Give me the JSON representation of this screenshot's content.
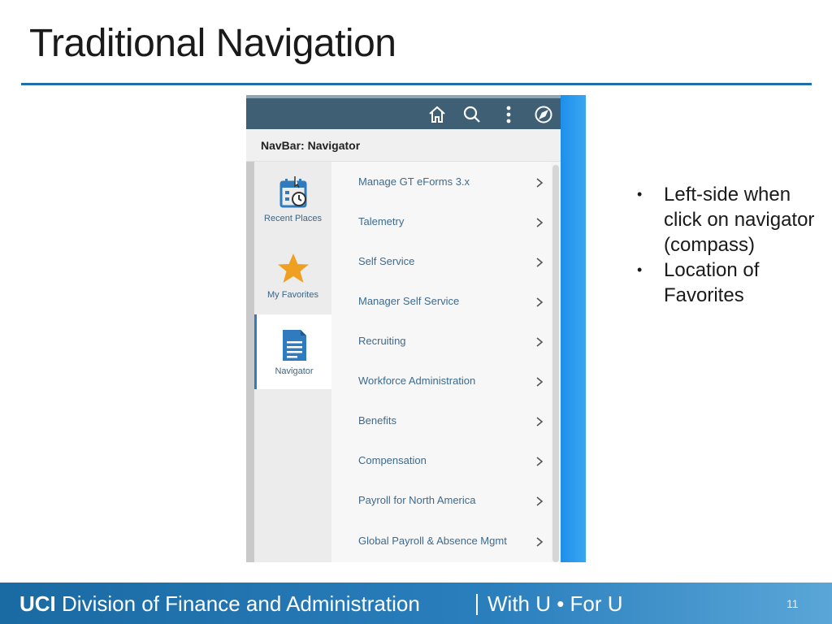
{
  "slide": {
    "title": "Traditional Navigation",
    "page_number": "11"
  },
  "navbar": {
    "header_icons": [
      "home-icon",
      "search-icon",
      "more-options-icon",
      "compass-icon"
    ],
    "title": "NavBar: Navigator",
    "tabs": [
      {
        "label": "Recent Places",
        "icon": "recent-places-icon",
        "active": false
      },
      {
        "label": "My Favorites",
        "icon": "star-icon",
        "active": false
      },
      {
        "label": "Navigator",
        "icon": "document-icon",
        "active": true
      }
    ],
    "menu_items": [
      {
        "label": "Manage GT eForms 3.x"
      },
      {
        "label": "Talemetry"
      },
      {
        "label": "Self Service"
      },
      {
        "label": "Manager Self Service"
      },
      {
        "label": "Recruiting"
      },
      {
        "label": "Workforce Administration"
      },
      {
        "label": "Benefits"
      },
      {
        "label": "Compensation"
      },
      {
        "label": "Payroll for North America"
      },
      {
        "label": "Global Payroll & Absence Mgmt"
      }
    ]
  },
  "bullets": [
    "Left-side when click on navigator (compass)",
    "Location of Favorites"
  ],
  "footer": {
    "brand_bold": "UCI",
    "brand_rest": "Division of Finance and Administration",
    "tagline": "With U • For U"
  },
  "colors": {
    "accent": "#1f6ea8",
    "header": "#3f5f75",
    "link": "#3d6a8f",
    "star": "#f0a020"
  }
}
